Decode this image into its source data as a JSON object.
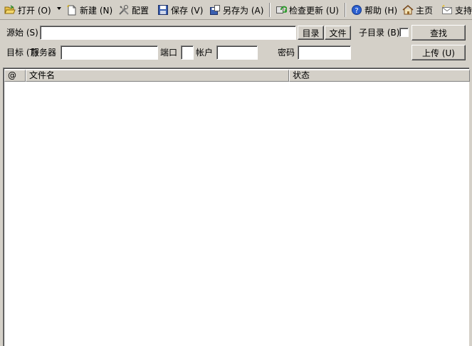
{
  "toolbar": {
    "open": "打开 (O)",
    "new": "新建 (N)",
    "config": "配置",
    "save": "保存 (V)",
    "save_as": "另存为 (A)",
    "check_update": "检查更新 (U)",
    "help": "帮助 (H)",
    "home": "主页",
    "support": "支持"
  },
  "form": {
    "source_label": "源始 (S)",
    "source_value": "",
    "dir_button": "目录",
    "file_button": "文件",
    "subdir_label": "子目录 (B)",
    "find_button": "查找",
    "target_label": "目标 (T)",
    "server_label": "服务器",
    "server_value": "",
    "port_label": "端口",
    "port_value": "",
    "account_label": "帐户",
    "account_value": "",
    "password_label": "密码",
    "password_value": "",
    "upload_button": "上传 (U)"
  },
  "list": {
    "columns": [
      "@",
      "文件名",
      "状态"
    ],
    "rows": []
  },
  "colors": {
    "window_bg": "#d4d0c8",
    "list_bg": "#ffffff"
  }
}
